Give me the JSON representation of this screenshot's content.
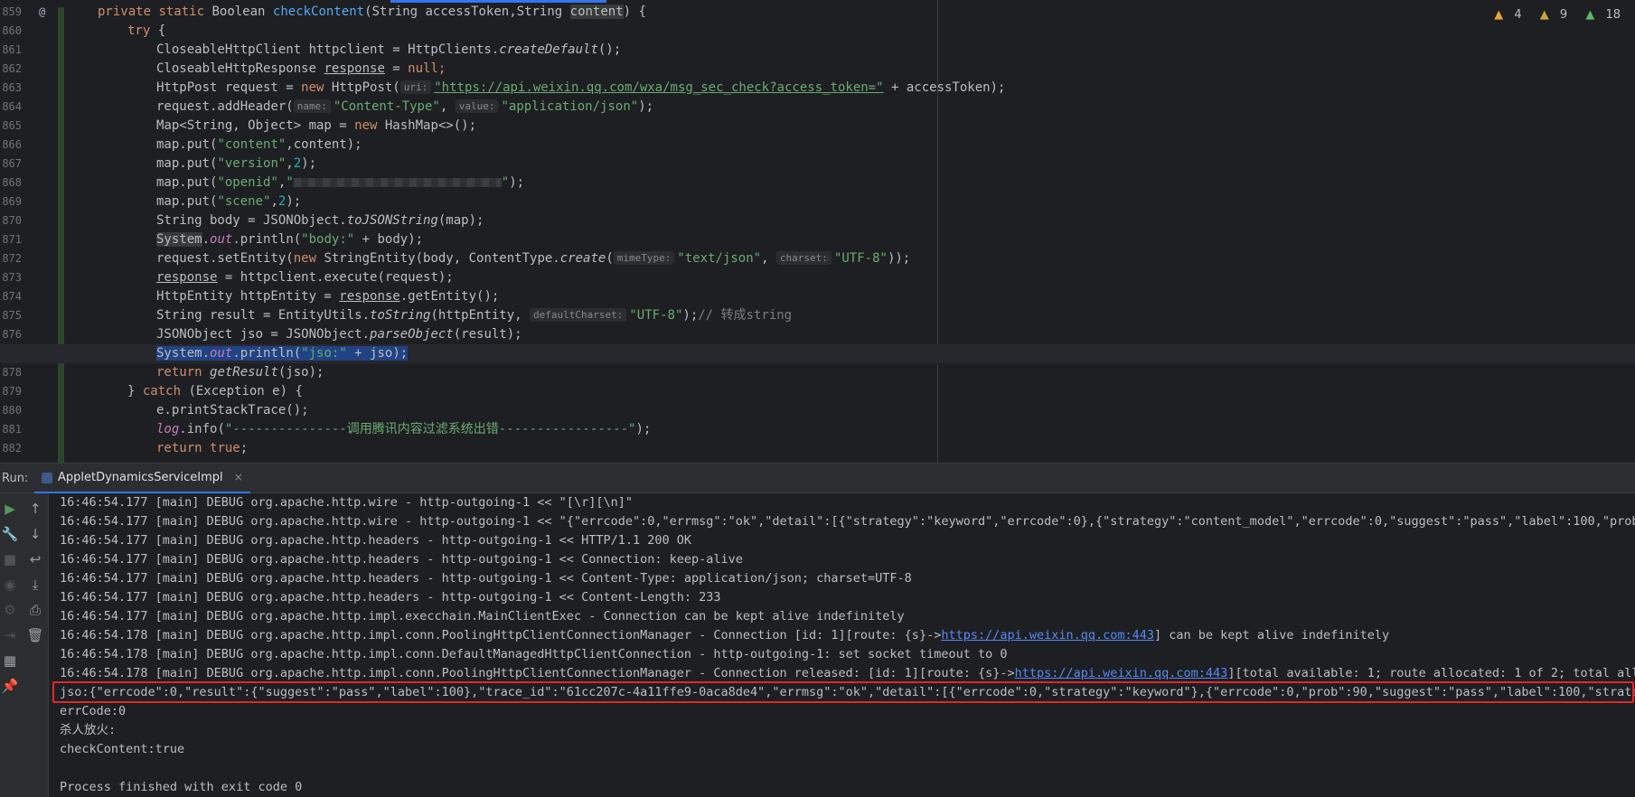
{
  "editor": {
    "inspections": {
      "warnings": "4",
      "weak_warnings": "9",
      "typos": "18"
    },
    "gutter_marker": "@",
    "line_numbers": [
      "859",
      "860",
      "861",
      "862",
      "863",
      "864",
      "865",
      "866",
      "867",
      "868",
      "869",
      "870",
      "871",
      "872",
      "873",
      "874",
      "875",
      "876",
      "877",
      "878",
      "879",
      "880",
      "881",
      "882"
    ],
    "lines": {
      "l859": {
        "mod": "private",
        "st": "static",
        "type": "Boolean ",
        "name": "checkContent",
        "params_a": "(String accessToken,String ",
        "params_b": "content",
        "params_c": ") {"
      },
      "l860": {
        "kw": "try",
        "rest": " {"
      },
      "l861": {
        "a": "CloseableHttpClient httpclient = HttpClients.",
        "b": "createDefault",
        "c": "();"
      },
      "l862": {
        "a": "CloseableHttpResponse ",
        "b": "response",
        "c": " = ",
        "d": "null",
        "e": ";"
      },
      "l863": {
        "a": "HttpPost request = ",
        "kw": "new",
        "b": " HttpPost(",
        "hint": "uri:",
        "url": "\"https://api.weixin.qq.com/wxa/msg_sec_check?access_token=\"",
        "c": " + accessToken);"
      },
      "l864": {
        "a": "request.addHeader(",
        "hint1": "name:",
        "s1": "\"Content-Type\"",
        "b": ", ",
        "hint2": "value:",
        "s2": "\"application/json\"",
        "c": ");"
      },
      "l865": {
        "a": "Map<String, Object> map = ",
        "kw": "new",
        "b": " HashMap<>();"
      },
      "l866": {
        "a": "map.put(",
        "s": "\"content\"",
        "b": ",content);"
      },
      "l867": {
        "a": "map.put(",
        "s": "\"version\"",
        "b": ",",
        "n": "2",
        "c": ");"
      },
      "l868": {
        "a": "map.put(",
        "s1": "\"openid\"",
        "b": ",",
        "s2": "\"",
        "s3": "\"",
        "c": ");"
      },
      "l869": {
        "a": "map.put(",
        "s": "\"scene\"",
        "b": ",",
        "n": "2",
        "c": ");"
      },
      "l870": {
        "a": "String body = JSONObject.",
        "b": "toJSONString",
        "c": "(map);"
      },
      "l871": {
        "a": "System",
        "dot": ".",
        "f": "out",
        "b": ".println(",
        "s": "\"body:\"",
        "c": " + body);"
      },
      "l872": {
        "a": "request.setEntity(",
        "kw": "new",
        "b": " StringEntity(body, ContentType.",
        "m": "create",
        "c": "(",
        "hint1": "mimeType:",
        "s1": "\"text/json\"",
        "d": ", ",
        "hint2": "charset:",
        "s2": "\"UTF-8\"",
        "e": "));"
      },
      "l873": {
        "a": "response",
        "b": " = httpclient.execute(request);"
      },
      "l874": {
        "a": "HttpEntity httpEntity = ",
        "b": "response",
        "c": ".getEntity();"
      },
      "l875": {
        "a": "String result = EntityUtils.",
        "m": "toString",
        "b": "(httpEntity, ",
        "hint": "defaultCharset:",
        "s": "\"UTF-8\"",
        "c": ");",
        "cmt": "// 转成string"
      },
      "l876": {
        "a": "JSONObject jso = JSONObject.",
        "m": "parseObject",
        "b": "(result);"
      },
      "l877": {
        "a": "System",
        "dot": ".",
        "f": "out",
        "b": ".println(",
        "s": "\"jso:\"",
        "c": " + jso);"
      },
      "l878": {
        "kw": "return",
        "a": " ",
        "m": "getResult",
        "b": "(jso);"
      },
      "l879": {
        "a": "} ",
        "kw": "catch",
        "b": " (Exception e) {"
      },
      "l880": {
        "a": "e.printStackTrace();"
      },
      "l881": {
        "f": "log",
        "a": ".info(",
        "s": "\"---------------调用腾讯内容过滤系统出错-----------------\"",
        "b": ");"
      },
      "l882": {
        "kw": "return",
        "a": " ",
        "kw2": "true",
        "b": ";"
      }
    }
  },
  "run_panel": {
    "label": "Run:",
    "tab_title": "AppletDynamicsServiceImpl",
    "tab_close": "×",
    "console": [
      "16:46:54.177 [main] DEBUG org.apache.http.wire - http-outgoing-1 << \"[\\r][\\n]\"",
      "16:46:54.177 [main] DEBUG org.apache.http.wire - http-outgoing-1 << \"{\"errcode\":0,\"errmsg\":\"ok\",\"detail\":[{\"strategy\":\"keyword\",\"errcode\":0},{\"strategy\":\"content_model\",\"errcode\":0,\"suggest\":\"pass\",\"label\":100,\"prob\":9",
      "16:46:54.177 [main] DEBUG org.apache.http.headers - http-outgoing-1 << HTTP/1.1 200 OK",
      "16:46:54.177 [main] DEBUG org.apache.http.headers - http-outgoing-1 << Connection: keep-alive",
      "16:46:54.177 [main] DEBUG org.apache.http.headers - http-outgoing-1 << Content-Type: application/json; charset=UTF-8",
      "16:46:54.177 [main] DEBUG org.apache.http.headers - http-outgoing-1 << Content-Length: 233",
      "16:46:54.177 [main] DEBUG org.apache.http.impl.execchain.MainClientExec - Connection can be kept alive indefinitely"
    ],
    "conn_line": {
      "a": "16:46:54.178 [main] DEBUG org.apache.http.impl.conn.PoolingHttpClientConnectionManager - Connection [id: 1][route: {s}->",
      "link": "https://api.weixin.qq.com:443",
      "b": "] can be kept alive indefinitely"
    },
    "socket_line": "16:46:54.178 [main] DEBUG org.apache.http.impl.conn.DefaultManagedHttpClientConnection - http-outgoing-1: set socket timeout to 0",
    "released_line": {
      "a": "16:46:54.178 [main] DEBUG org.apache.http.impl.conn.PoolingHttpClientConnectionManager - Connection released: [id: 1][route: {s}->",
      "link": "https://api.weixin.qq.com:443",
      "b": "][total available: 1; route allocated: 1 of 2; total alloca"
    },
    "jso_line": "jso:{\"errcode\":0,\"result\":{\"suggest\":\"pass\",\"label\":100},\"trace_id\":\"61cc207c-4a11ffe9-0aca8de4\",\"errmsg\":\"ok\",\"detail\":[{\"errcode\":0,\"strategy\":\"keyword\"},{\"errcode\":0,\"prob\":90,\"suggest\":\"pass\",\"label\":100,\"strategy\"",
    "errcode_line": "errCode:0",
    "test_line": "杀人放火:",
    "check_line": "checkContent:true",
    "exit_line": "Process finished with exit code 0",
    "highlight_color": "#e0282a"
  }
}
